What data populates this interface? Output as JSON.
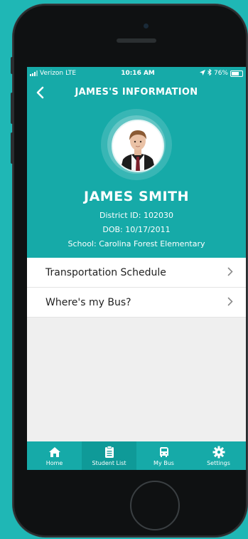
{
  "status_bar": {
    "carrier": "Verizon",
    "network": "LTE",
    "time": "10:16 AM",
    "battery": "76%"
  },
  "nav": {
    "title": "JAMES'S INFORMATION",
    "back_icon": "chevron-left-icon"
  },
  "student": {
    "name": "JAMES SMITH",
    "district_id": "District ID: 102030",
    "dob": "DOB: 10/17/2011",
    "school": "School: Carolina Forest Elementary"
  },
  "menu": {
    "items": [
      {
        "label": "Transportation Schedule",
        "icon": "chevron-right-icon"
      },
      {
        "label": "Where's my Bus?",
        "icon": "chevron-right-icon"
      }
    ]
  },
  "tabbar": {
    "active": "Student List",
    "tabs": [
      {
        "label": "Home",
        "icon": "home-icon"
      },
      {
        "label": "Student List",
        "icon": "clipboard-icon"
      },
      {
        "label": "My Bus",
        "icon": "bus-icon"
      },
      {
        "label": "Settings",
        "icon": "gear-icon"
      }
    ]
  },
  "colors": {
    "background": "#1fb7b5",
    "primary": "#16aaa8",
    "active_tab": "#0f9a98"
  }
}
